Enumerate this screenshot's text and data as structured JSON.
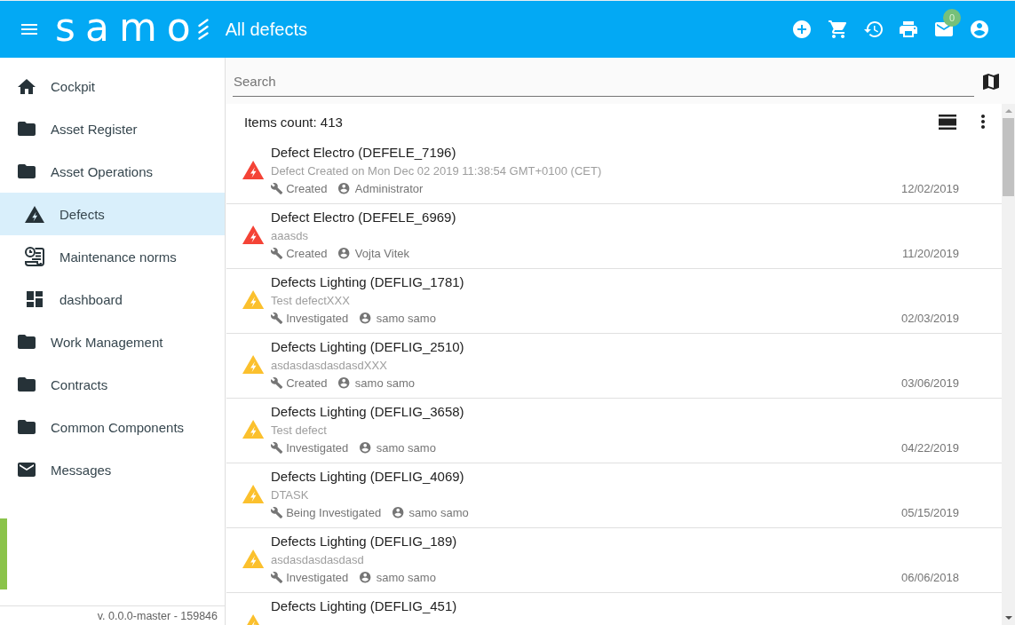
{
  "app_bar": {
    "logo": "samo",
    "title": "All defects",
    "mail_badge": "0"
  },
  "sidebar": {
    "items": [
      {
        "label": "Cockpit",
        "kind": "home",
        "selected": false
      },
      {
        "label": "Asset Register",
        "kind": "folder",
        "selected": false
      },
      {
        "label": "Asset Operations",
        "kind": "folder",
        "selected": false,
        "children": [
          {
            "label": "Defects",
            "kind": "defects",
            "selected": true
          },
          {
            "label": "Maintenance norms",
            "kind": "norms",
            "selected": false
          },
          {
            "label": "dashboard",
            "kind": "dashboard",
            "selected": false
          }
        ]
      },
      {
        "label": "Work Management",
        "kind": "folder",
        "selected": false
      },
      {
        "label": "Contracts",
        "kind": "folder",
        "selected": false
      },
      {
        "label": "Common Components",
        "kind": "folder",
        "selected": false
      },
      {
        "label": "Messages",
        "kind": "messages",
        "selected": false
      }
    ],
    "version": "v. 0.0.0-master - 159846"
  },
  "search": {
    "placeholder": "Search"
  },
  "list": {
    "count": "Items count: 413",
    "items": [
      {
        "title": "Defect Electro (DEFELE_7196)",
        "description": "Defect Created on Mon Dec 02 2019 11:38:54 GMT+0100 (CET)",
        "status": "Created",
        "user": "Administrator",
        "date": "12/02/2019",
        "color": "#f44336"
      },
      {
        "title": "Defect Electro (DEFELE_6969)",
        "description": "aaasds",
        "status": "Created",
        "user": "Vojta Vitek",
        "date": "11/20/2019",
        "color": "#f44336"
      },
      {
        "title": "Defects Lighting (DEFLIG_1781)",
        "description": "Test defectXXX",
        "status": "Investigated",
        "user": "samo samo",
        "date": "02/03/2019",
        "color": "#fbc02d"
      },
      {
        "title": "Defects Lighting (DEFLIG_2510)",
        "description": "asdasdasdasdasdXXX",
        "status": "Created",
        "user": "samo samo",
        "date": "03/06/2019",
        "color": "#fbc02d"
      },
      {
        "title": "Defects Lighting (DEFLIG_3658)",
        "description": "Test defect",
        "status": "Investigated",
        "user": "samo samo",
        "date": "04/22/2019",
        "color": "#fbc02d"
      },
      {
        "title": "Defects Lighting (DEFLIG_4069)",
        "description": "DTASK",
        "status": "Being Investigated",
        "user": "samo samo",
        "date": "05/15/2019",
        "color": "#fbc02d"
      },
      {
        "title": "Defects Lighting (DEFLIG_189)",
        "description": "asdasdasdasdasd",
        "status": "Investigated",
        "user": "samo samo",
        "date": "06/06/2018",
        "color": "#fbc02d"
      },
      {
        "title": "Defects Lighting (DEFLIG_451)",
        "color": "#fbc02d"
      }
    ]
  }
}
